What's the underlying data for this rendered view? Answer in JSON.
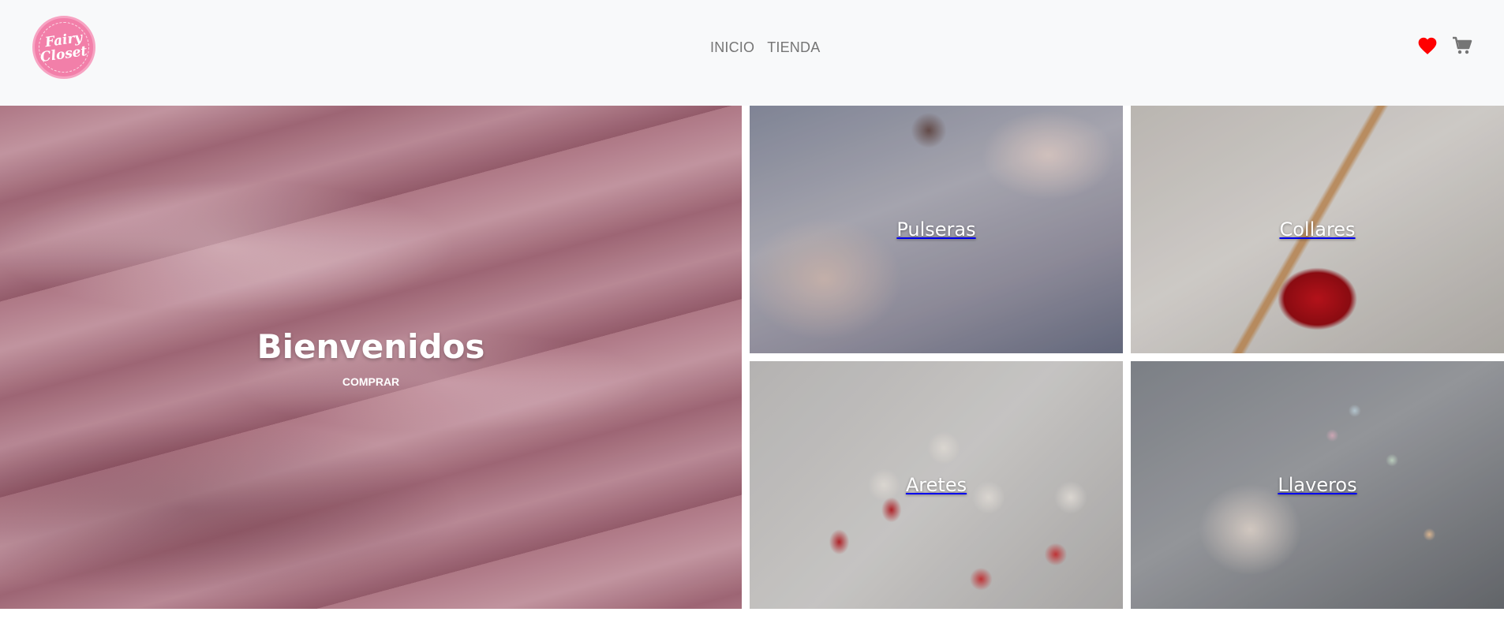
{
  "brand": {
    "logo_line1": "Fairy",
    "logo_line2": "Closet"
  },
  "nav": {
    "items": [
      {
        "label": "INICIO"
      },
      {
        "label": "TIENDA"
      }
    ]
  },
  "header_icons": {
    "favorites": {
      "icon": "heart-icon",
      "color": "#ff0000"
    },
    "cart": {
      "icon": "cart-icon",
      "color": "#757575"
    }
  },
  "hero": {
    "title": "Bienvenidos",
    "cta_label": "COMPRAR"
  },
  "categories": [
    {
      "label": "Pulseras"
    },
    {
      "label": "Collares"
    },
    {
      "label": "Aretes"
    },
    {
      "label": "Llaveros"
    }
  ],
  "colors": {
    "header_bg": "#f8f9fa",
    "nav_text": "#757575",
    "logo_pink": "#f27fa9"
  }
}
